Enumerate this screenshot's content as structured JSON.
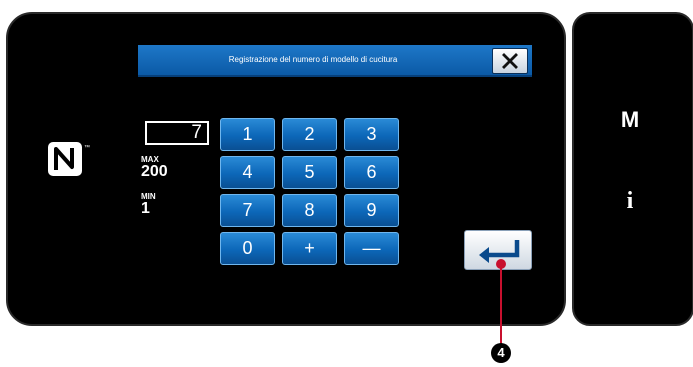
{
  "dialog": {
    "title": "Registrazione del numero di modello di cucitura",
    "close_icon": "close-icon"
  },
  "input": {
    "value": "7",
    "max_label": "MAX",
    "max_value": "200",
    "min_label": "MIN",
    "min_value": "1"
  },
  "keypad": {
    "keys": [
      "1",
      "2",
      "3",
      "4",
      "5",
      "6",
      "7",
      "8",
      "9",
      "0",
      "+",
      "—"
    ]
  },
  "enter": {
    "icon": "enter-arrow-icon"
  },
  "side": {
    "mode_label": "M",
    "info_label": "i"
  },
  "status": {
    "nfc_icon": "nfc-icon"
  },
  "callout": {
    "number": "4"
  },
  "colors": {
    "key_blue": "#0c67b8",
    "title_blue": "#1e78c8",
    "callout_red": "#c8102e"
  }
}
